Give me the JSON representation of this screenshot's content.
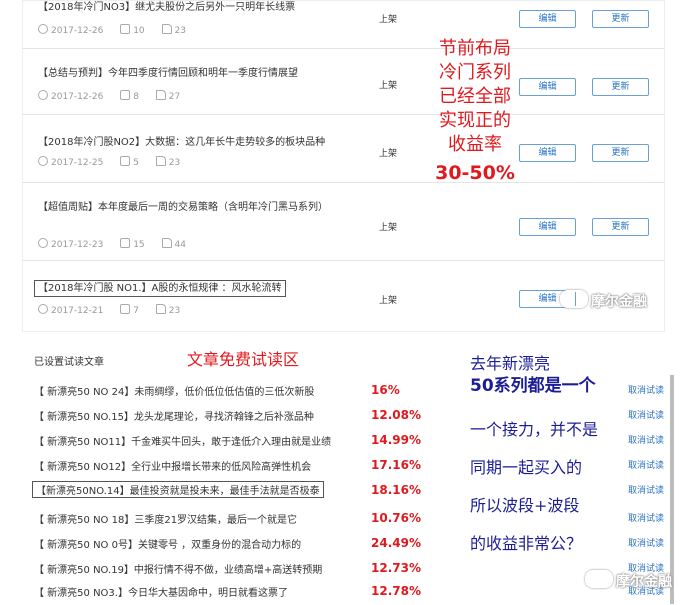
{
  "articles": [
    {
      "title": "【2018年冷门NO3】继尤夫股份之后另外一只明年长线票",
      "date": "2017-12-26",
      "comments": "10",
      "likes": "23",
      "status": "上架",
      "edit": "编辑",
      "update": "更新"
    },
    {
      "title": "【总结与预判】今年四季度行情回顾和明年一季度行情展望",
      "date": "2017-12-26",
      "comments": "8",
      "likes": "27",
      "status": "上架",
      "edit": "编辑",
      "update": "更新"
    },
    {
      "title": "【2018年冷门股NO2】大数据：这几年长牛走势较多的板块品种",
      "date": "2017-12-25",
      "comments": "5",
      "likes": "23",
      "status": "上架",
      "edit": "编辑",
      "update": "更新"
    },
    {
      "title": "【超值周贴】本年度最后一周的交易策略（含明年冷门黑马系列）",
      "date": "2017-12-23",
      "comments": "15",
      "likes": "44",
      "status": "上架",
      "edit": "编辑",
      "update": "更新"
    },
    {
      "title": "【2018年冷门股 NO1.】A股的永恒规律 ：风水轮流转",
      "date": "2017-12-21",
      "comments": "7",
      "likes": "23",
      "status": "上架",
      "edit": "编辑",
      "update": "更新"
    }
  ],
  "trial": {
    "section_title": "已设置试读文章",
    "cancel_label": "取消试读",
    "items": [
      {
        "title": "【 新漂亮50 NO 24】未雨绸缪，低价低位低估值的三低次新股",
        "pct": "16%"
      },
      {
        "title": "【 新漂亮50 NO.15】龙头龙尾理论，寻找济翰锋之后补涨品种",
        "pct": "12.08%"
      },
      {
        "title": "【 新漂亮50 NO11】千金难买牛回头，敢于逢低介入理由就是业绩",
        "pct": "14.99%"
      },
      {
        "title": "【 新漂亮50 NO12】全行业中报增长带来的低风险高弹性机会",
        "pct": "17.16%"
      },
      {
        "title": "【新漂亮50NO.14】最佳投资就是投未来，最佳手法就是否极泰",
        "pct": "18.16%"
      },
      {
        "title": "【 新漂亮50 NO 18】三季度21罗汉结集，最后一个就是它",
        "pct": "10.76%"
      },
      {
        "title": "【 新漂亮50 NO 0号】关键零号 ，双重身份的混合动力标的",
        "pct": "24.49%"
      },
      {
        "title": "【 新漂亮50 NO.19】中报行情不得不做，业绩高增+高送转预期",
        "pct": "12.73%"
      },
      {
        "title": "【 新漂亮50 NO3.】今日华大基因命中，明日就看这票了",
        "pct": "12.78%"
      }
    ]
  },
  "annotations": {
    "top_lines": [
      "节前布局",
      "冷门系列",
      "已经全部",
      "实现正的",
      "收益率"
    ],
    "top_range": "30-50%",
    "free_trial": "文章免费试读区",
    "blue_lines": [
      "去年新漂亮",
      "50系列都是一个",
      "一个接力，并不是",
      "同期一起买入的",
      "所以波段+波段",
      "的收益非常公？"
    ]
  },
  "watermark": "摩尔金融",
  "colors": {
    "accent_red": "#e0191e",
    "note_blue": "#1c1e96",
    "link_blue": "#2a73c4"
  }
}
